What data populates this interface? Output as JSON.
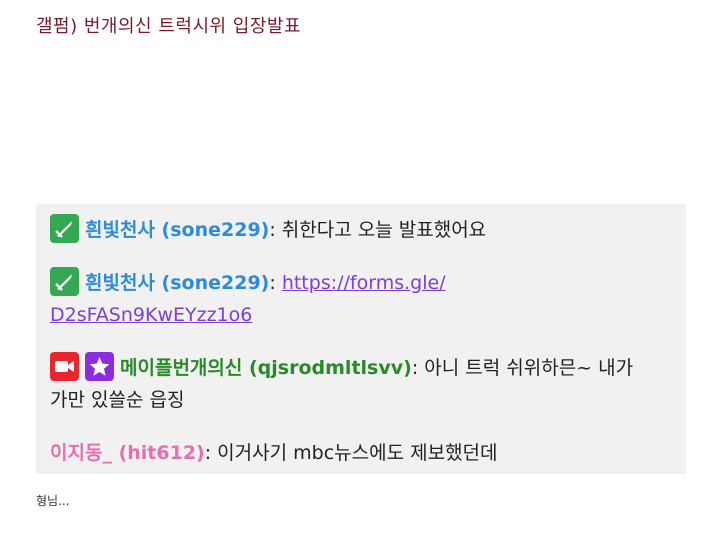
{
  "post": {
    "title": "갤펌) 번개의신 트럭시위 입장발표",
    "footer": "형님..."
  },
  "chat": {
    "messages": [
      {
        "badges": [
          "sword-icon"
        ],
        "username": "흰빛천사",
        "handle": "(sone229)",
        "separator": ":",
        "text": " 취한다고 오늘 발표했어요",
        "name_color": "#2e8bd8"
      },
      {
        "badges": [
          "sword-icon"
        ],
        "username": "흰빛천사",
        "handle": "(sone229)",
        "separator": ":",
        "text": " ",
        "link": "https://forms.gle/D2sFASn9KwEYzz1o6",
        "link_line1": "https://forms.gle/",
        "link_line2": "D2sFASn9KwEYzz1o6",
        "name_color": "#2e8bd8"
      },
      {
        "badges": [
          "video-camera-icon",
          "star-icon"
        ],
        "username": "메이플번개의신",
        "handle": "(qjsrodmltlsvv)",
        "separator": ":",
        "text": " 아니 트럭 쉬위하믄~ 내가",
        "text_line2": "가만 있쓸순 읍징",
        "name_color": "#2a8a2a"
      },
      {
        "badges": [],
        "username": "이지동_",
        "handle": "(hit612)",
        "separator": ":",
        "text": " 이거사기 mbc뉴스에도 제보했던데",
        "name_color": "#e66fb3"
      }
    ]
  }
}
